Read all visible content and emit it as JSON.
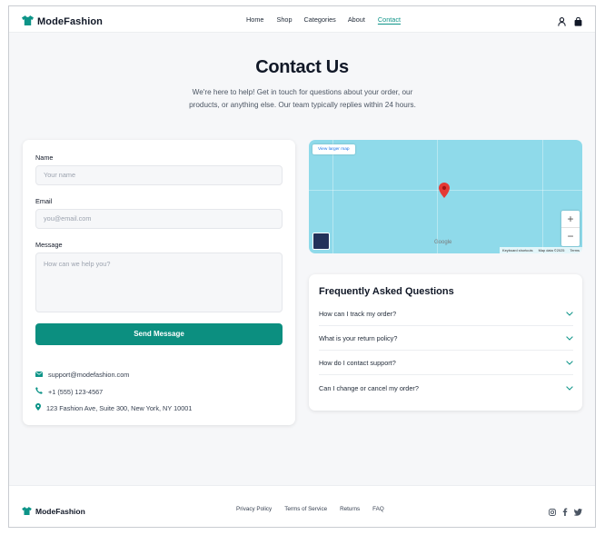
{
  "header": {
    "brand": "ModeFashion",
    "nav": [
      {
        "label": "Home"
      },
      {
        "label": "Shop"
      },
      {
        "label": "Categories"
      },
      {
        "label": "About"
      },
      {
        "label": "Contact",
        "active": true
      }
    ],
    "icons": [
      "user-icon",
      "shopping-bag-icon"
    ]
  },
  "hero": {
    "title": "Contact Us",
    "subtitle": "We're here to help! Get in touch for questions about your order, our products, or anything else. Our team typically replies within 24 hours."
  },
  "form": {
    "name_label": "Name",
    "name_placeholder": "Your name",
    "email_label": "Email",
    "email_placeholder": "you@email.com",
    "message_label": "Message",
    "message_placeholder": "How can we help you?",
    "submit_label": "Send Message",
    "contact": {
      "email": "support@modefashion.com",
      "phone": "+1 (555) 123-4567",
      "address": "123 Fashion Ave, Suite 300, New York, NY 10001"
    }
  },
  "map": {
    "larger_map_label": "View larger map",
    "google_label": "Google",
    "attribution": [
      "Keyboard shortcuts",
      "Map data ©2025",
      "Terms"
    ],
    "zoom_in": "+",
    "zoom_out": "−"
  },
  "faq": {
    "title": "Frequently Asked Questions",
    "items": [
      {
        "question": "How can I track my order?"
      },
      {
        "question": "What is your return policy?"
      },
      {
        "question": "How do I contact support?"
      },
      {
        "question": "Can I change or cancel my order?"
      }
    ]
  },
  "footer": {
    "brand": "ModeFashion",
    "links": [
      "Privacy Policy",
      "Terms of Service",
      "Returns",
      "FAQ"
    ],
    "social_icons": [
      "instagram-icon",
      "facebook-icon",
      "twitter-icon"
    ]
  },
  "colors": {
    "accent": "#0d9488",
    "button": "#0c8f80",
    "map_water": "#8fdaea",
    "pin": "#e53935"
  }
}
